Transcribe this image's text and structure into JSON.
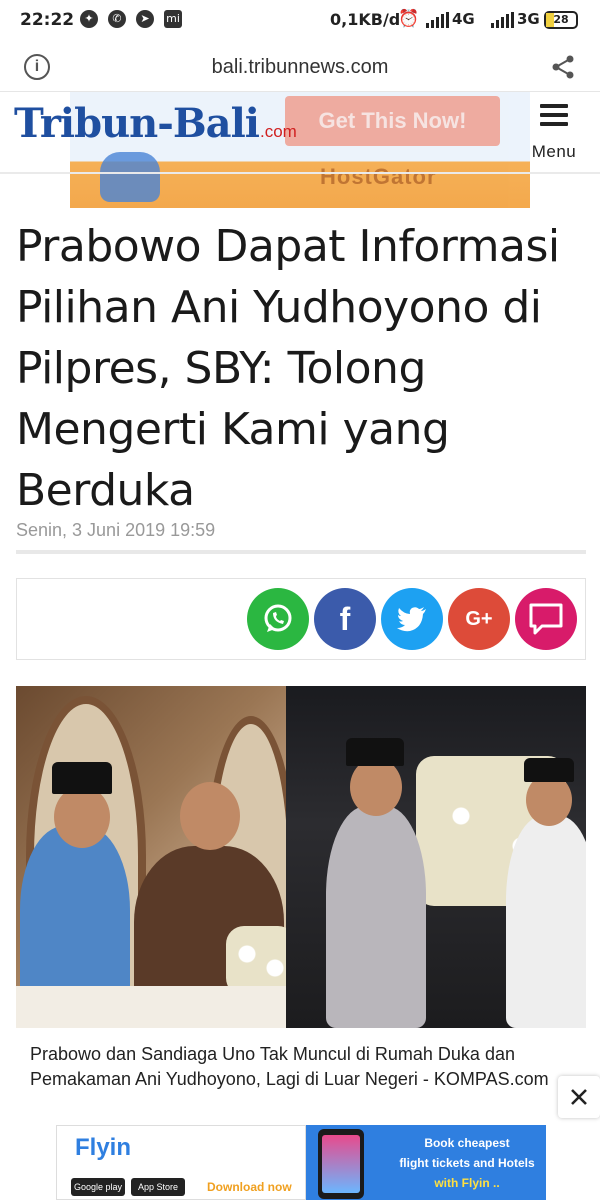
{
  "status_bar": {
    "time": "22:22",
    "net_speed": "0,1KB/d",
    "sim1": "4G",
    "sim2": "3G",
    "battery": "28",
    "battery_level": 0.28,
    "icons": [
      "messenger-icon",
      "whatsapp-icon",
      "telegram-icon",
      "mi-icon",
      "alarm-icon",
      "signal-icon",
      "battery-icon"
    ]
  },
  "browser": {
    "url": "bali.tribunnews.com",
    "icons": [
      "info-icon",
      "share-icon"
    ]
  },
  "header": {
    "logo_main": "Tribun-Bali",
    "logo_suffix": ".com",
    "menu_label": "Menu",
    "ad": {
      "cta": "Get This Now!",
      "brand": "HostGator"
    }
  },
  "article": {
    "headline": "Prabowo Dapat Informasi Pilihan Ani Yudhoyono di Pilpres, SBY: Tolong Mengerti Kami yang Berduka",
    "date": "Senin, 3 Juni 2019 19:59",
    "share_buttons": [
      {
        "name": "whatsapp",
        "color": "#2bb741",
        "icon": "whatsapp-icon"
      },
      {
        "name": "facebook",
        "color": "#3b5bab",
        "icon": "facebook-icon"
      },
      {
        "name": "twitter",
        "color": "#1da1f2",
        "icon": "twitter-icon"
      },
      {
        "name": "google-plus",
        "color": "#dd4b39",
        "icon": "google-plus-icon"
      },
      {
        "name": "comment",
        "color": "#d81b6a",
        "icon": "comment-icon"
      }
    ],
    "facebook_glyph": "f",
    "gplus_glyph": "G+",
    "caption": "Prabowo dan Sandiaga Uno Tak Muncul di Rumah Duka dan Pemakaman Ani Yudhoyono, Lagi di Luar Negeri - KOMPAS.com"
  },
  "bottom_ad": {
    "brand": "Flyin",
    "store1": "Google play",
    "store2": "App Store",
    "download": "Download now",
    "line1": "Book cheapest",
    "line2": "flight tickets and Hotels",
    "line3": "with Flyin .."
  }
}
